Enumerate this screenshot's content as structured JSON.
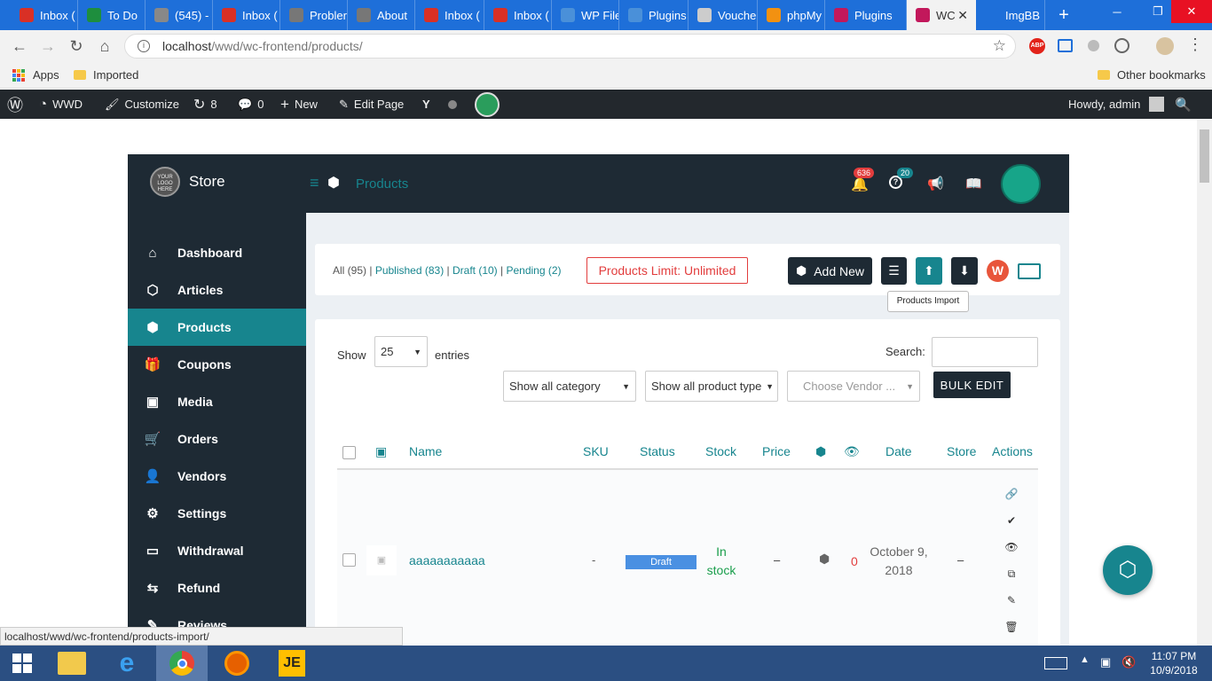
{
  "browser": {
    "tabs": [
      {
        "title": "Inbox (",
        "icon": "gmail-icon",
        "color": "#d93025"
      },
      {
        "title": "To Do",
        "icon": "sheets-icon",
        "color": "#1e8e3e"
      },
      {
        "title": "(545) -",
        "icon": "generic-icon",
        "color": "#888888"
      },
      {
        "title": "Inbox (",
        "icon": "gmail-icon",
        "color": "#d93025"
      },
      {
        "title": "Probler",
        "icon": "gear-icon",
        "color": "#777777"
      },
      {
        "title": "About",
        "icon": "gear-icon",
        "color": "#777777"
      },
      {
        "title": "Inbox (",
        "icon": "gmail-icon",
        "color": "#d93025"
      },
      {
        "title": "Inbox (",
        "icon": "gmail-icon",
        "color": "#d93025"
      },
      {
        "title": "WP File",
        "icon": "plugin-icon",
        "color": "#4a90d9"
      },
      {
        "title": "Plugins",
        "icon": "plugin-icon",
        "color": "#4a90d9"
      },
      {
        "title": "Vouche",
        "icon": "doc-icon",
        "color": "#cccccc"
      },
      {
        "title": "phpMy",
        "icon": "php-icon",
        "color": "#f29111"
      },
      {
        "title": "Plugins",
        "icon": "wcfm-icon",
        "color": "#c2185b"
      },
      {
        "title": "WC",
        "icon": "wcfm-icon",
        "color": "#c2185b"
      },
      {
        "title": "ImgBB",
        "icon": "imgbb-icon",
        "color": "#1e6fd9"
      }
    ],
    "url_host": "localhost",
    "url_path": "/wwd/wc-frontend/products/",
    "bookmarks": {
      "apps": "Apps",
      "imported": "Imported",
      "other": "Other bookmarks"
    },
    "status_url": "localhost/wwd/wc-frontend/products-import/"
  },
  "adminbar": {
    "site": "WWD",
    "customize": "Customize",
    "updates": "8",
    "comments": "0",
    "new": "New",
    "edit": "Edit Page",
    "howdy": "Howdy, admin"
  },
  "store": {
    "logo_text": "YOUR LOGO HERE",
    "name": "Store",
    "page_title": "Products",
    "notifications": "636",
    "help_count": "20"
  },
  "sidebar": {
    "items": [
      {
        "label": "Dashboard",
        "icon": "home-icon",
        "glyph": "⌂"
      },
      {
        "label": "Articles",
        "icon": "cube-icon",
        "glyph": "⬡"
      },
      {
        "label": "Products",
        "icon": "cubes-icon",
        "glyph": "⬢",
        "active": true
      },
      {
        "label": "Coupons",
        "icon": "gift-icon",
        "glyph": "🎁"
      },
      {
        "label": "Media",
        "icon": "image-icon",
        "glyph": "▣"
      },
      {
        "label": "Orders",
        "icon": "cart-icon",
        "glyph": "🛒"
      },
      {
        "label": "Vendors",
        "icon": "user-icon",
        "glyph": "👤"
      },
      {
        "label": "Settings",
        "icon": "cogs-icon",
        "glyph": "⚙"
      },
      {
        "label": "Withdrawal",
        "icon": "card-icon",
        "glyph": "▭"
      },
      {
        "label": "Refund",
        "icon": "refund-icon",
        "glyph": "⇆"
      },
      {
        "label": "Reviews",
        "icon": "comment-icon",
        "glyph": "✎"
      }
    ]
  },
  "filters": {
    "all": "All (95)",
    "published": "Published (83)",
    "draft": "Draft (10)",
    "pending": "Pending (2)",
    "limit": "Products Limit: Unlimited",
    "add_new": "Add New",
    "tooltip": "Products Import"
  },
  "table_controls": {
    "show": "Show",
    "entries_value": "25",
    "entries": "entries",
    "search": "Search:",
    "category": "Show all category",
    "product_type": "Show all product type",
    "vendor_placeholder": "Choose Vendor ...",
    "bulk_edit": "BULK EDIT"
  },
  "table": {
    "headers": {
      "name": "Name",
      "sku": "SKU",
      "status": "Status",
      "stock": "Stock",
      "price": "Price",
      "date": "Date",
      "store": "Store",
      "actions": "Actions"
    },
    "rows": [
      {
        "name": "aaaaaaaaaaa",
        "sku": "-",
        "status": "Draft",
        "stock_1": "In",
        "stock_2": "stock",
        "price": "–",
        "views": "0",
        "date_1": "October 9,",
        "date_2": "2018",
        "store": "–"
      }
    ]
  },
  "taskbar": {
    "time": "11:07 PM",
    "date": "10/9/2018"
  },
  "colors": {
    "accent": "#17858e",
    "dark": "#1e2a34",
    "draft": "#4a90e2",
    "chrome_blue": "#1e6fd9",
    "limit_red": "#e23d3d"
  }
}
